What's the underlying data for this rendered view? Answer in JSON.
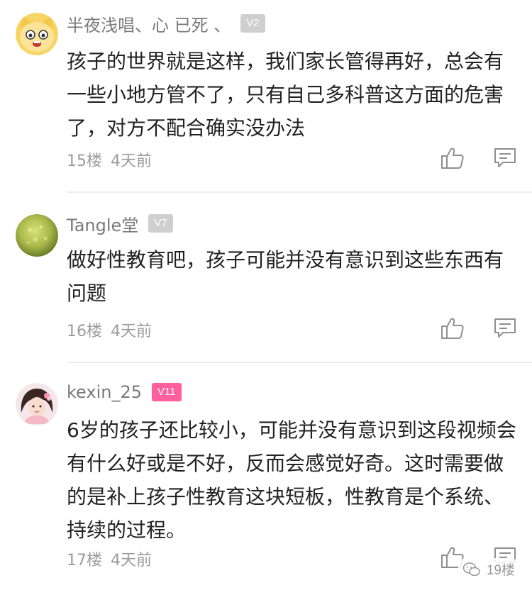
{
  "comments": [
    {
      "username": "半夜浅唱、心 已死 、",
      "level": "V2",
      "text": "孩子的世界就是这样，我们家长管得再好，总会有一些小地方管不了，只有自己多科普这方面的危害了，对方不配合确实没办法",
      "floor": "15楼",
      "time": "4天前"
    },
    {
      "username": "Tangle堂",
      "level": "V7",
      "text": "做好性教育吧，孩子可能并没有意识到这些东西有问题",
      "floor": "16楼",
      "time": "4天前"
    },
    {
      "username": "kexin_25",
      "level": "V11",
      "text": "6岁的孩子还比较小，可能并没有意识到这段视频会有什么好或是不好，反而会感觉好奇。这时需要做的是补上孩子性教育这块短板，性教育是个系统、持续的过程。",
      "floor": "17楼",
      "time": "4天前"
    }
  ],
  "icons": {
    "like": "thumbs-up-icon",
    "reply": "chat-bubble-icon"
  },
  "colors": {
    "level_low": "#cfcfcf",
    "level_high": "#ff5f9c",
    "meta_text": "#9b9b9b"
  },
  "watermark": {
    "text": "19楼"
  }
}
